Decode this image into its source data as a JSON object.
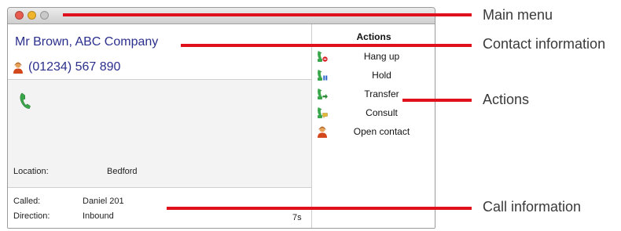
{
  "window": {
    "titlebar": {
      "close": "close-button",
      "minimize": "minimize-button",
      "zoom": "zoom-button"
    },
    "contact": {
      "name": "Mr Brown, ABC Company",
      "phone": "(01234) 567 890"
    },
    "call": {
      "location_label": "Location:",
      "location_value": "Bedford",
      "called_label": "Called:",
      "called_value": "Daniel 201",
      "direction_label": "Direction:",
      "direction_value": "Inbound",
      "duration": "7s"
    },
    "actions": {
      "header": "Actions",
      "items": [
        {
          "label": "Hang up",
          "icon": "hang-up-icon"
        },
        {
          "label": "Hold",
          "icon": "hold-icon"
        },
        {
          "label": "Transfer",
          "icon": "transfer-icon"
        },
        {
          "label": "Consult",
          "icon": "consult-icon"
        },
        {
          "label": "Open contact",
          "icon": "open-contact-icon"
        }
      ]
    }
  },
  "callouts": {
    "main_menu": "Main menu",
    "contact_information": "Contact information",
    "actions": "Actions",
    "call_information": "Call information"
  },
  "colors": {
    "accent_text": "#2b2f8c",
    "callout_line": "#e0101c",
    "close": "#e85b4f",
    "minimize": "#f0b52b"
  }
}
